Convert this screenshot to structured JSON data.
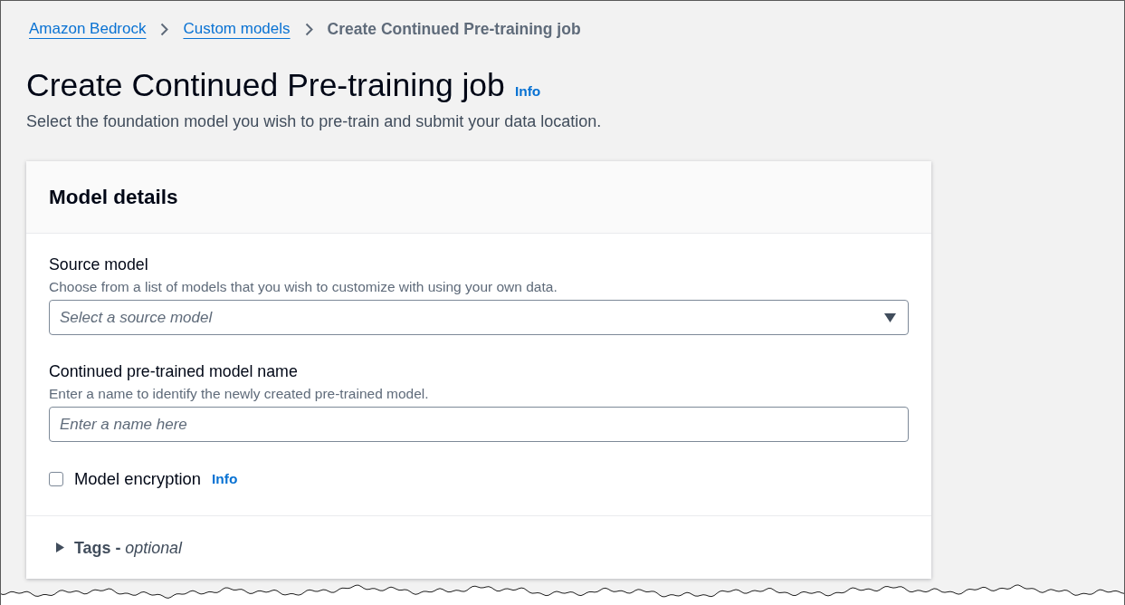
{
  "breadcrumbs": [
    {
      "label": "Amazon Bedrock",
      "kind": "link"
    },
    {
      "label": "Custom models",
      "kind": "link"
    },
    {
      "label": "Create Continued Pre-training job",
      "kind": "current"
    }
  ],
  "page_header": {
    "title": "Create Continued Pre-training job",
    "info_link": "Info",
    "description": "Select the foundation model you wish to pre-train and submit your data location."
  },
  "model_details": {
    "title": "Model details",
    "fields": [
      {
        "kind": "select",
        "label": "Source model",
        "description": "Choose from a list of models that you wish to customize with using your own data.",
        "placeholder": "Select a source model"
      },
      {
        "kind": "text",
        "label": "Continued pre-trained model name",
        "description": "Enter a name to identify the newly created pre-trained model.",
        "placeholder": "Enter a name here"
      },
      {
        "kind": "checkbox",
        "label": "Model encryption",
        "info_link": "Info",
        "checked": false
      }
    ],
    "tags_section": {
      "label": "**Tags -** *optional*",
      "expanded": false
    }
  }
}
